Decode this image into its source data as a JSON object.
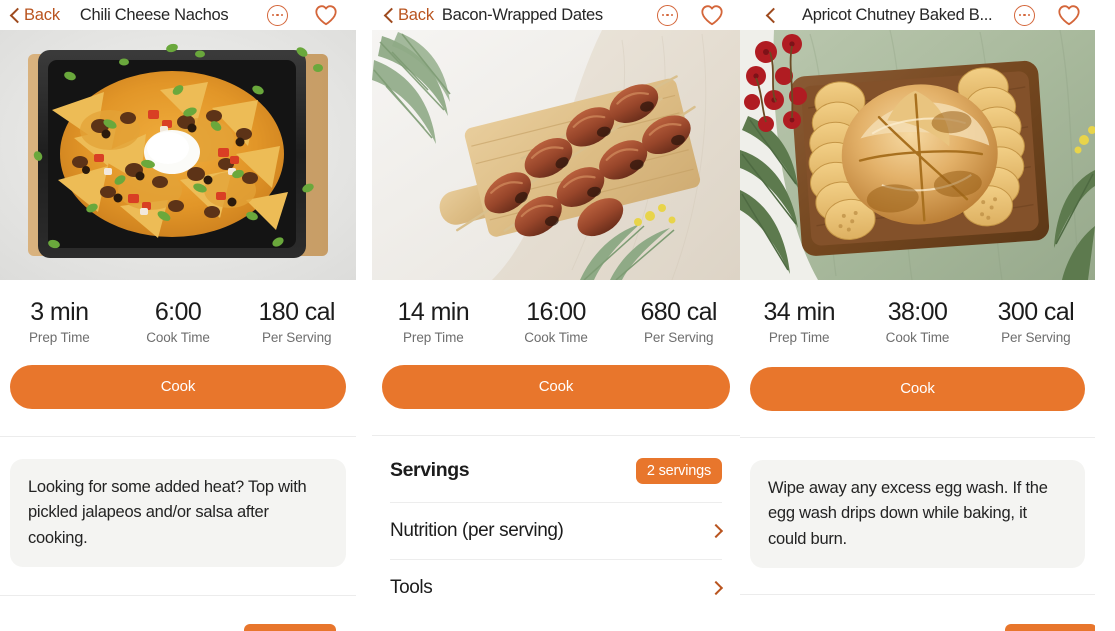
{
  "panels": [
    {
      "nav": {
        "back_label": "Back",
        "title": "Chili Cheese Nachos",
        "more_icon": "more-options-icon",
        "favorite_icon": "heart-outline-icon"
      },
      "hero": {
        "alt": "Chili cheese nachos in a black tray with sour cream and scallions"
      },
      "stats": [
        {
          "value": "3 min",
          "label": "Prep Time"
        },
        {
          "value": "6:00",
          "label": "Cook Time"
        },
        {
          "value": "180 cal",
          "label": "Per Serving"
        }
      ],
      "cook_label": "Cook",
      "tip": "Looking for some added heat? Top with pickled jalapeos and/or salsa after cooking."
    },
    {
      "nav": {
        "back_label": "Back",
        "title": "Bacon-Wrapped Dates",
        "more_icon": "more-options-icon",
        "favorite_icon": "heart-outline-icon"
      },
      "hero": {
        "alt": "Bacon-wrapped dates on skewers on a wooden paddle board"
      },
      "stats": [
        {
          "value": "14 min",
          "label": "Prep Time"
        },
        {
          "value": "16:00",
          "label": "Cook Time"
        },
        {
          "value": "680 cal",
          "label": "Per Serving"
        }
      ],
      "cook_label": "Cook",
      "servings": {
        "title": "Servings",
        "badge": "2 servings"
      },
      "rows": [
        {
          "label": "Nutrition (per serving)"
        },
        {
          "label": "Tools"
        }
      ]
    },
    {
      "nav": {
        "back_label": "",
        "title": "Apricot Chutney Baked B...",
        "more_icon": "more-options-icon",
        "favorite_icon": "heart-outline-icon"
      },
      "hero": {
        "alt": "Apricot chutney baked brie in pastry with crackers on a wooden board"
      },
      "stats": [
        {
          "value": "34 min",
          "label": "Prep Time"
        },
        {
          "value": "38:00",
          "label": "Cook Time"
        },
        {
          "value": "300 cal",
          "label": "Per Serving"
        }
      ],
      "cook_label": "Cook",
      "tip": "Wipe away any excess egg wash. If the egg wash drips down while baking, it could burn."
    }
  ],
  "colors": {
    "accent_orange": "#e8762c",
    "back_link": "#b9541f",
    "tip_background": "#f4f4f2",
    "text_primary": "#1c1c1c",
    "text_secondary": "#6e6e6e"
  }
}
